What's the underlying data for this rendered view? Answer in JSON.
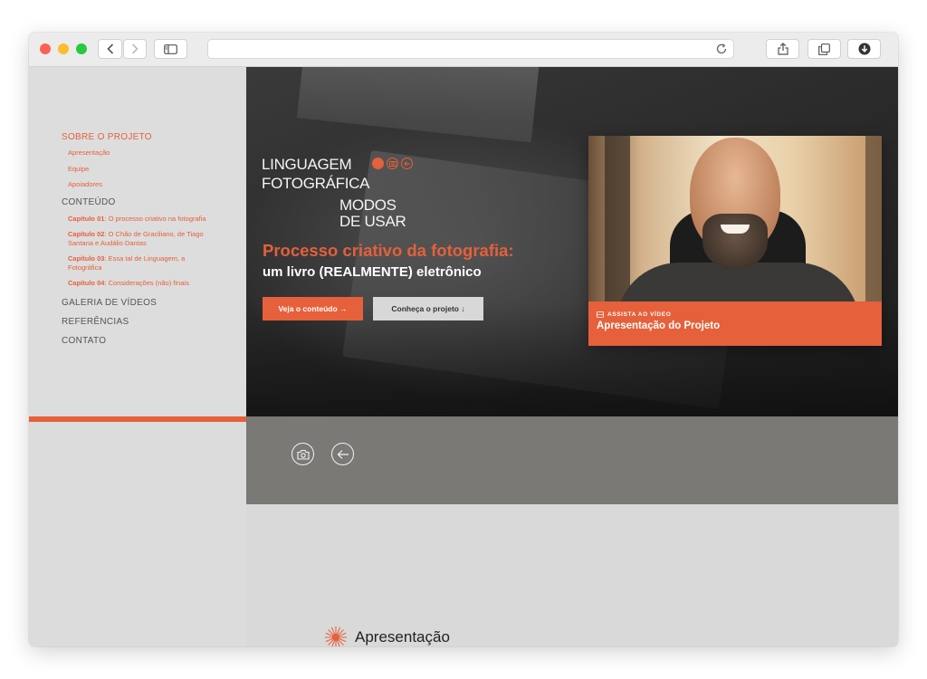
{
  "nav": {
    "sobre": "SOBRE O PROJETO",
    "apresentacao": "Apresentação",
    "equipe": "Equipe",
    "apoiadores": "Apoiadores",
    "conteudo": "CONTEÚDO",
    "chapters": [
      {
        "prefix": "Capítulo 01",
        "text": ": O processo criativo na fotografia"
      },
      {
        "prefix": "Capítulo 02",
        "text": ": O Chão de Graciliano, de Tiago Santana e Audálio Dantas"
      },
      {
        "prefix": "Capítulo 03",
        "text": ": Essa tal de Linguagem, a Fotográfica"
      },
      {
        "prefix": "Capítulo 04",
        "text": ": Considerações (não) finais"
      }
    ],
    "galeria": "GALERIA DE VÍDEOS",
    "referencias": "REFERÊNCIAS",
    "contato": "CONTATO"
  },
  "logo": {
    "line1": "LINGUAGEM",
    "line2": "FOTOGRÁFICA",
    "line3": "MODOS",
    "line4": "DE USAR"
  },
  "hero": {
    "headline": "Processo criativo da fotografia:",
    "subline": "um livro (REALMENTE) eletrônico",
    "primary_button": "Veja o conteúdo →",
    "secondary_button": "Conheça o projeto ↓"
  },
  "video": {
    "kicker": "ASSISTA AO VÍDEO",
    "title": "Apresentação do Projeto"
  },
  "section": {
    "title": "Apresentação"
  },
  "colors": {
    "accent": "#e5603b",
    "sidebar_bg": "#dddddd",
    "band_bg": "#7b7976"
  },
  "icons": [
    "camera-icon",
    "arrow-left-circle-icon",
    "sunburst-icon",
    "film-icon"
  ]
}
